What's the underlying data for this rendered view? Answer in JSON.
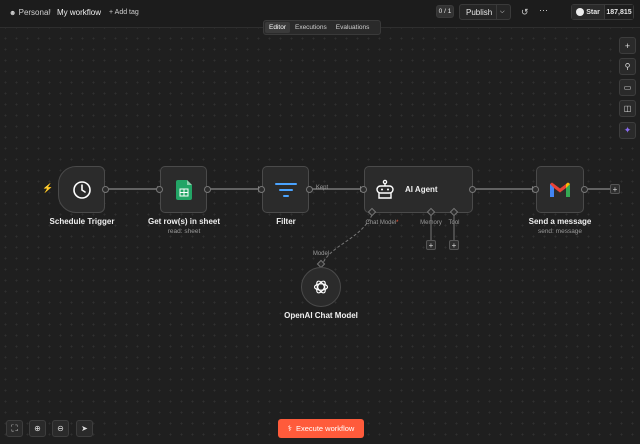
{
  "header": {
    "project": "Personal",
    "workflow_name": "My workflow",
    "add_tag": "+ Add tag",
    "counter": "0 / 1",
    "publish_label": "Publish",
    "github_star_label": "Star",
    "github_star_count": "187,815"
  },
  "tabs": [
    {
      "label": "Editor",
      "active": true
    },
    {
      "label": "Executions",
      "active": false
    },
    {
      "label": "Evaluations",
      "active": false
    }
  ],
  "nodes": {
    "schedule_trigger": {
      "name": "Schedule Trigger",
      "icon": "clock-icon"
    },
    "get_rows": {
      "name": "Get row(s) in sheet",
      "subtitle": "read: sheet",
      "icon": "google-sheets-icon"
    },
    "filter": {
      "name": "Filter",
      "output_label": "Kept",
      "icon": "filter-icon"
    },
    "ai_agent": {
      "name": "AI Agent",
      "icon": "robot-icon",
      "inputs": {
        "chat_model": "Chat Model",
        "required_marker": "*",
        "memory": "Memory",
        "tool": "Tool"
      }
    },
    "send_message": {
      "name": "Send a message",
      "subtitle": "send: message",
      "icon": "gmail-icon"
    },
    "openai_model": {
      "name": "OpenAI Chat Model",
      "output_label": "Model",
      "icon": "openai-icon"
    }
  },
  "execute_button": "Execute workflow",
  "colors": {
    "accent": "#ff5b3b",
    "trigger_bolt": "#ff5b3b",
    "ai_sparkle": "#8a6cf0",
    "sheets_green": "#23a566"
  }
}
